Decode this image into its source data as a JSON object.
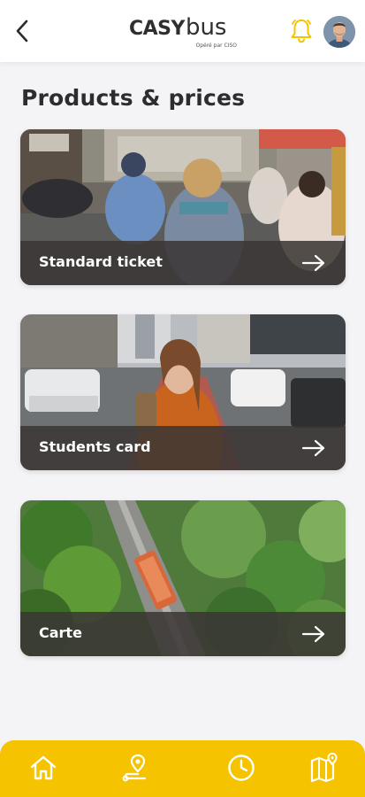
{
  "header": {
    "back_icon": "chevron-left-icon",
    "logo_text_casy": "CASY",
    "logo_text_bus": "bus",
    "logo_subtitle": "Opéré par CISO",
    "notification_icon": "bell-icon",
    "avatar_alt": "user avatar"
  },
  "page": {
    "title": "Products & prices"
  },
  "products": [
    {
      "label": "Standard ticket",
      "image": "street traffic with scooters",
      "icon": "arrow-right-icon"
    },
    {
      "label": "Students card",
      "image": "smiling student in city street",
      "icon": "arrow-right-icon"
    },
    {
      "label": "Carte",
      "image": "aerial view of bus among trees",
      "icon": "arrow-right-icon"
    }
  ],
  "tabbar": {
    "items": [
      {
        "name": "home",
        "icon": "home-icon"
      },
      {
        "name": "route",
        "icon": "route-pin-icon"
      },
      {
        "name": "schedule",
        "icon": "clock-icon"
      },
      {
        "name": "map",
        "icon": "map-icon"
      }
    ]
  },
  "colors": {
    "accent": "#f5c300",
    "bell": "#f5c300",
    "background": "#f4f4f6",
    "card_bar": "#3a3634"
  }
}
